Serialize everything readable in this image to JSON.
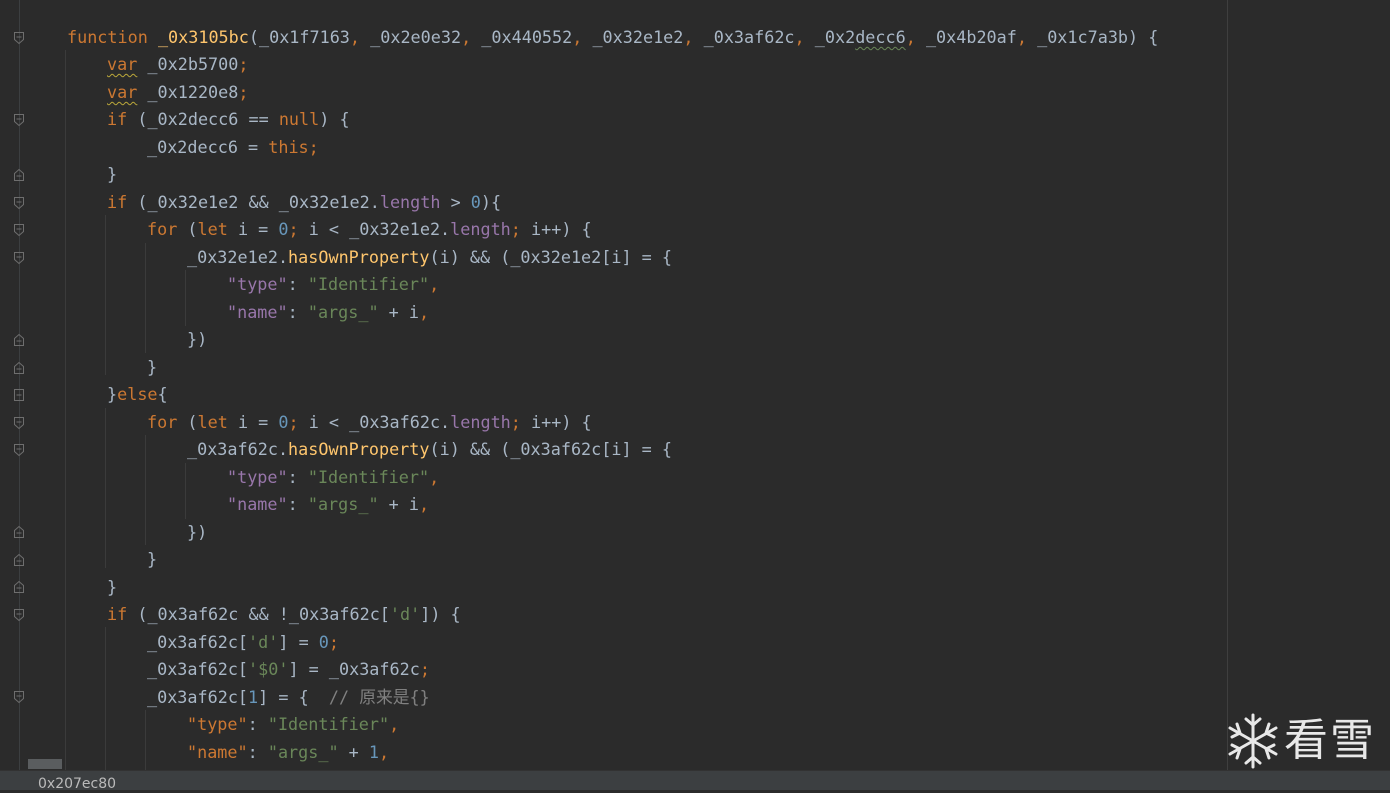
{
  "status_bar": {
    "text": "0x207ec80"
  },
  "watermark": {
    "text": "看雪",
    "logo_icon": "snowflake-icon"
  },
  "colors": {
    "background": "#2b2b2b",
    "keyword": "#cc7832",
    "function_name": "#ffc66d",
    "string": "#6a8759",
    "number": "#6897bb",
    "property": "#9876aa",
    "comment": "#808080",
    "default_text": "#a9b7c6"
  },
  "code": {
    "l1": {
      "kw": "function",
      "name": "_0x3105bc",
      "p1": "_0x1f7163",
      "p2": "_0x2e0e32",
      "p3": "_0x440552",
      "p4": "_0x32e1e2",
      "p5": "_0x3af62c",
      "p6a": "_0x2",
      "p6b": "decc6",
      "p7": "_0x4b20af",
      "p8": "_0x1c7a3b"
    },
    "l2": {
      "kw": "var",
      "id": "_0x2b5700"
    },
    "l3": {
      "kw": "var",
      "id": "_0x1220e8"
    },
    "l4": {
      "kw": "if",
      "id": "_0x2decc6",
      "op": "==",
      "nul": "null"
    },
    "l5": {
      "id": "_0x2decc6",
      "kw": "this"
    },
    "l6": {
      "txt": "}"
    },
    "l7": {
      "kw": "if",
      "a": "_0x32e1e2",
      "b": "_0x32e1e2",
      "prop": "length",
      "num": "0"
    },
    "l8": {
      "kw": "for",
      "let": "let",
      "i": "i",
      "zero": "0",
      "cond": "i < _0x32e1e2",
      "prop": "length",
      "inc": "i++"
    },
    "l9": {
      "obj": "_0x32e1e2",
      "method": "hasOwnProperty",
      "mid": "(i) && (_0x32e1e2[i] = {"
    },
    "l10": {
      "key": "\"type\"",
      "val": "\"Identifier\""
    },
    "l11": {
      "key": "\"name\"",
      "val": "\"args_\"",
      "tail": " + i"
    },
    "l12": {
      "txt": "})"
    },
    "l13": {
      "txt": "}"
    },
    "l14": {
      "open": "}",
      "kw": "else",
      "close": "{"
    },
    "l15": {
      "kw": "for",
      "let": "let",
      "i": "i",
      "zero": "0",
      "cond": "i < _0x3af62c",
      "prop": "length",
      "inc": "i++"
    },
    "l16": {
      "obj": "_0x3af62c",
      "method": "hasOwnProperty",
      "mid": "(i) && (_0x3af62c[i] = {"
    },
    "l17": {
      "key": "\"type\"",
      "val": "\"Identifier\""
    },
    "l18": {
      "key": "\"name\"",
      "val": "\"args_\"",
      "tail": " + i"
    },
    "l19": {
      "txt": "})"
    },
    "l20": {
      "txt": "}"
    },
    "l21": {
      "txt": "}"
    },
    "l22": {
      "kw": "if",
      "a": "_0x3af62c && !_0x3af62c[",
      "s": "'d'"
    },
    "l23": {
      "a": "_0x3af62c[",
      "s": "'d'",
      "b": "] = ",
      "num": "0"
    },
    "l24": {
      "a": "_0x3af62c[",
      "s": "'$0'",
      "b": "] = _0x3af62c"
    },
    "l25": {
      "a": "_0x3af62c[",
      "num": "1",
      "b": "] = {  ",
      "cm": "// 原来是{}"
    },
    "l26": {
      "key": "\"type\"",
      "val": "\"Identifier\""
    },
    "l27": {
      "key": "\"name\"",
      "val": "\"args_\"",
      "tail": " + ",
      "num": "1"
    }
  }
}
